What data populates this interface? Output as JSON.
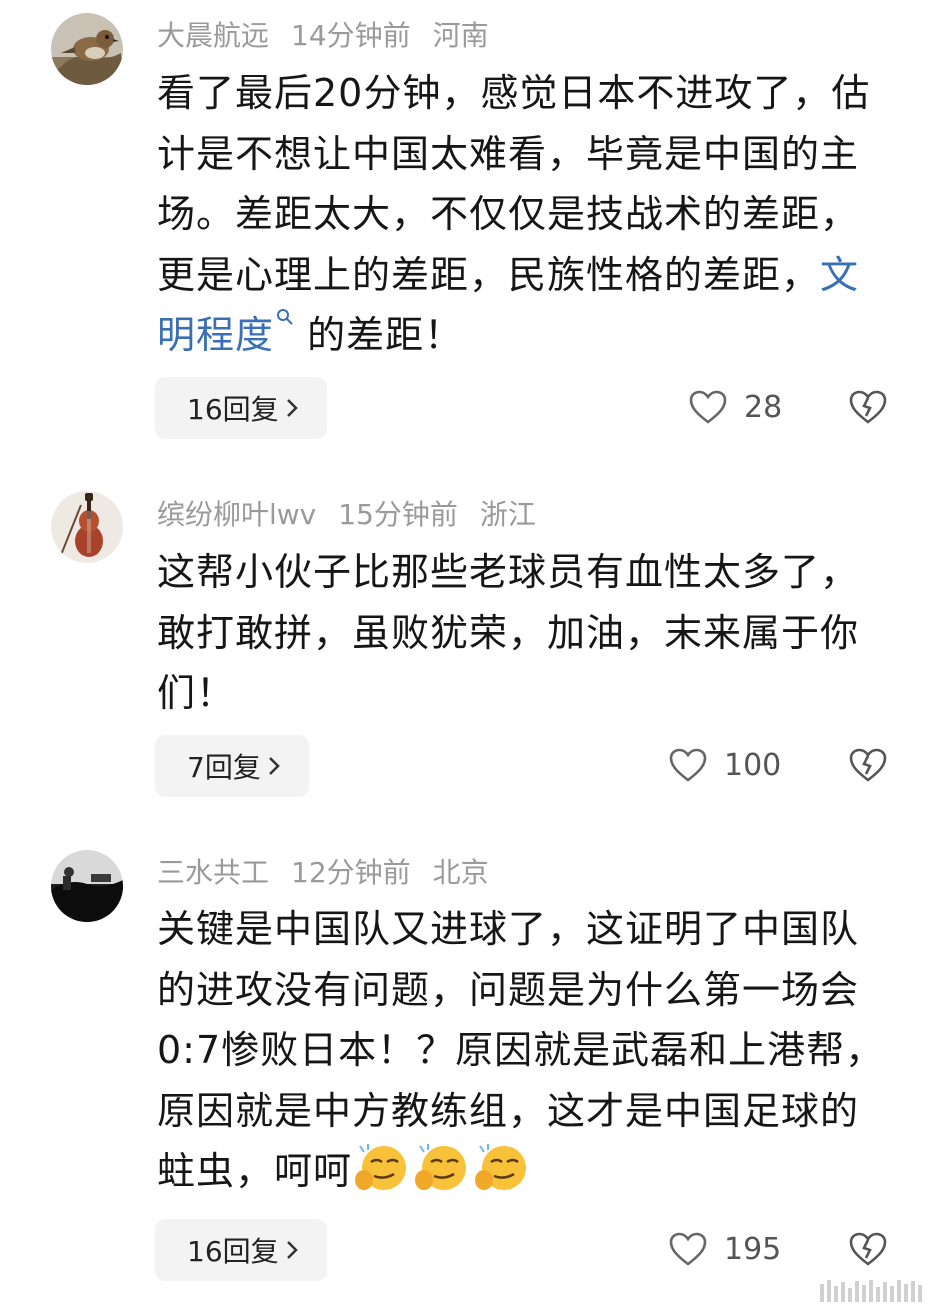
{
  "comments": [
    {
      "user": "大晨航远",
      "time": "14分钟前",
      "location": "河南",
      "avatar_icon": "sparrow-avatar",
      "text_pre": "看了最后20分钟，感觉日本不进攻了，估计是不想让中国太难看，毕竟是中国的主场。差距太大，不仅仅是技战术的差距，更是心理上的差距，民族性格的差距，",
      "link": "文明程度",
      "text_post": "的差距！",
      "reply_label": "16回复",
      "likes": "28"
    },
    {
      "user": "缤纷柳叶lwv",
      "time": "15分钟前",
      "location": "浙江",
      "avatar_icon": "violin-avatar",
      "text": "这帮小伙子比那些老球员有血性太多了，敢打敢拼，虽败犹荣，加油，末来属于你们！",
      "reply_label": "7回复",
      "likes": "100"
    },
    {
      "user": "三水共工",
      "time": "12分钟前",
      "location": "北京",
      "avatar_icon": "dark-photo-avatar",
      "text": "关键是中国队又进球了，这证明了中国队的进攻没有问题，问题是为什么第一场会0:7惨败日本！？原因就是武磊和上港帮，原因就是中方教练组，这才是中国足球的蛀虫，呵呵",
      "emoji_icon": "smirk-emoji",
      "reply_label": "16回复",
      "likes": "195"
    }
  ],
  "icons": {
    "like": "heart-outline-icon",
    "dislike": "broken-heart-icon",
    "chevron": "chevron-right-icon",
    "search": "search-icon"
  },
  "colors": {
    "link": "#3a6fb3",
    "meta": "#9a9a9a",
    "reply_bg": "#f3f3f3"
  }
}
